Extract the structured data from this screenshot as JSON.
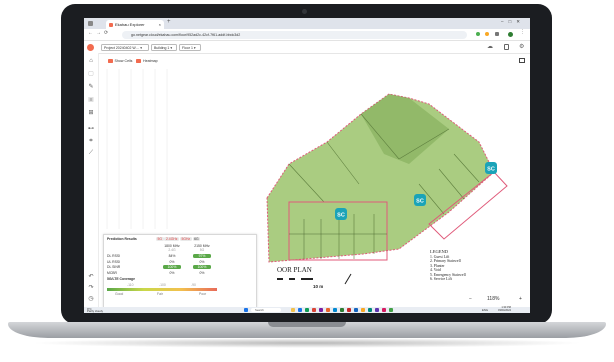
{
  "browser": {
    "tab_title": "Ekahau Explorer",
    "url": "go.netgear.cloud/ekahau.com/floor/952ad2c-42cf-7f61-addf-bbdc3d2",
    "window_controls": [
      "–",
      "□",
      "✕"
    ]
  },
  "app": {
    "project_label": "Project 20240402 W…",
    "building_label": "Building 1",
    "floor_label": "Floor 1",
    "checkbox1": "Show Cells",
    "checkbox2": "Heatmap"
  },
  "predictions": {
    "title": "Prediction Results",
    "badges": [
      "5G",
      "2.4GHz",
      "5GHz",
      "6G"
    ],
    "col1": "1800 MHz",
    "col1_sub": "2.4G",
    "col2": "2150 MHz",
    "col2_sub": "5G",
    "rows": [
      {
        "label": "DL RSSI",
        "v1": "84%",
        "v2": "97%"
      },
      {
        "label": "UL RSSI",
        "v1": "0%",
        "v2": "0%"
      },
      {
        "label": "DL SINR",
        "v1": "100%",
        "v2": "100%"
      },
      {
        "label": "MCBR",
        "v1": "0%",
        "v2": "0%"
      }
    ],
    "coverage_title": "5G/LTE Coverage",
    "scale_labels": [
      "-110",
      "-100",
      "-90"
    ],
    "scale_names": [
      "Good",
      "Fair",
      "Poor"
    ]
  },
  "plan": {
    "ap_badges": [
      "SC",
      "SC",
      "SC"
    ],
    "title_fragment": "OOR PLAN",
    "scale_text": "10 m"
  },
  "legend": {
    "title": "LEGEND",
    "items": [
      "1. Guest Lift",
      "2. Primary Stairwell",
      "3. Planter",
      "4. Void",
      "5. Emergency Stairwell",
      "6. Service Lift"
    ]
  },
  "zoom": {
    "minus": "−",
    "level": "118%",
    "plus": "+"
  },
  "taskbar": {
    "weather_temp": "9°C",
    "weather_desc": "Partly cloudy",
    "search": "Search",
    "lang": "ENG",
    "time": "1:30 PM",
    "date": "03/04/2024"
  },
  "colors": {
    "plan_fill": "#9bc36b",
    "plan_dark": "#7da955",
    "boundary": "#e05a7a",
    "ap_badge": "#1aa3b8",
    "accent": "#f26b4f"
  }
}
